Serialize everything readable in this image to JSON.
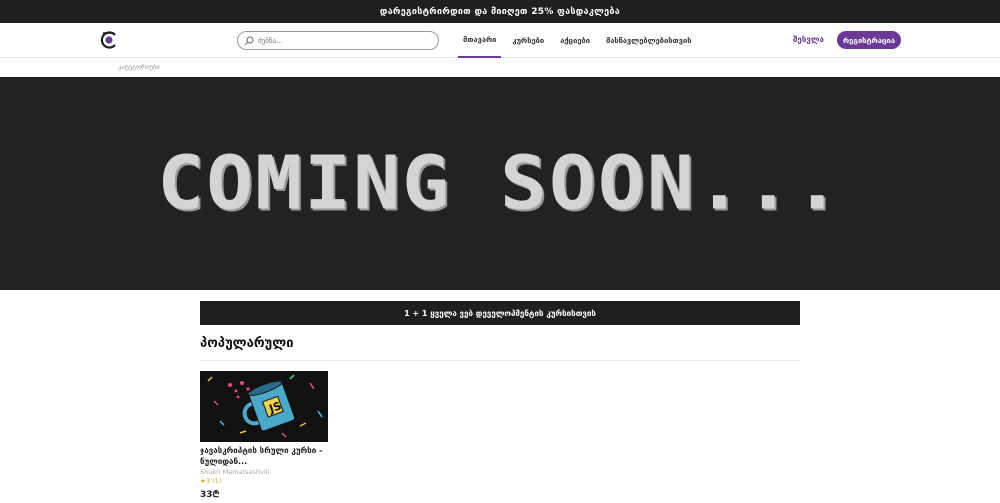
{
  "promo": {
    "text": "დარეგისტრირდით და მიიღეთ 25% ფასდაკლება"
  },
  "header": {
    "search_placeholder": "ძებნა...",
    "nav": [
      {
        "label": "მთავარი",
        "active": true
      },
      {
        "label": "კურსები"
      },
      {
        "label": "აქციები"
      },
      {
        "label": "მასწავლებლებისთვის"
      }
    ],
    "login_label": "შესვლა",
    "register_label": "რეგისტრაცია"
  },
  "categories": {
    "label": "კატეგორიები"
  },
  "hero": {
    "text": "COMING SOON..."
  },
  "deal_banner": {
    "text": "1 + 1 ყველა ვებ დეველოპმენტის კურსისთვის"
  },
  "popular": {
    "title": "პოპულარული",
    "courses": [
      {
        "title": "ჯავასკრიპტის სრული კურსი - ნულიდან...",
        "author": "Shukri Mamatsashvili",
        "rating": "★3 (1)",
        "price": "33₾"
      }
    ]
  },
  "colors": {
    "brand": "#6a3a96",
    "dark": "#1f1f1f"
  }
}
